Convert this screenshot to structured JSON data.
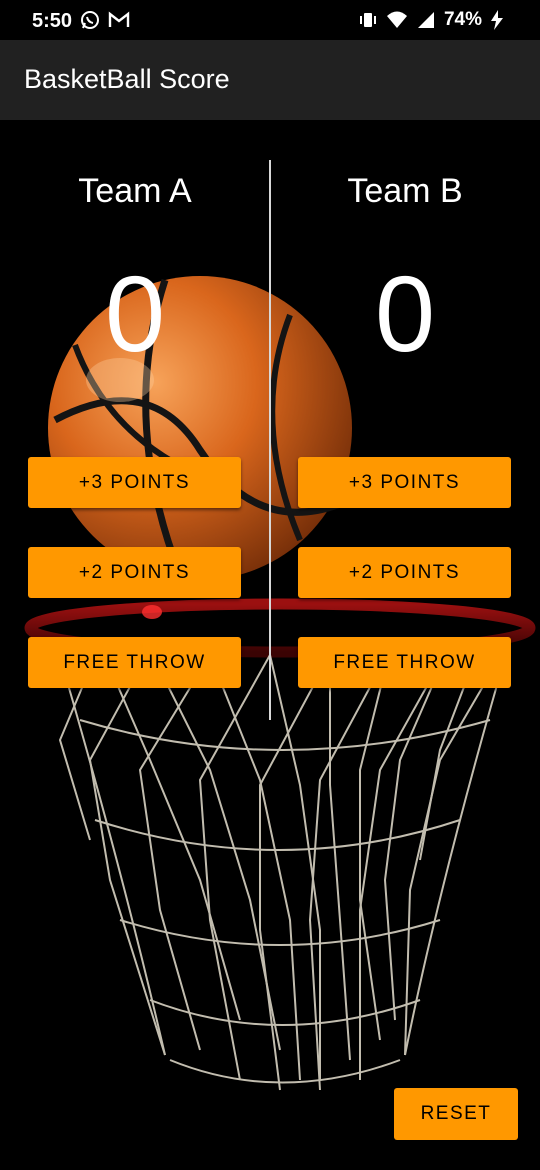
{
  "status_bar": {
    "time": "5:50",
    "battery": "74%",
    "icons": [
      "whatsapp-icon",
      "gmail-icon",
      "vibrate-icon",
      "wifi-icon",
      "signal-icon",
      "battery-charging-icon"
    ]
  },
  "app_bar": {
    "title": "BasketBall Score"
  },
  "team_a": {
    "name": "Team A",
    "score": "0",
    "btn_three": "+3 POINTS",
    "btn_two": "+2 POINTS",
    "btn_free": "FREE THROW"
  },
  "team_b": {
    "name": "Team B",
    "score": "0",
    "btn_three": "+3 POINTS",
    "btn_two": "+2 POINTS",
    "btn_free": "FREE THROW"
  },
  "reset_label": "RESET",
  "colors": {
    "accent": "#FF9800",
    "app_bar": "#212121",
    "background": "#000000"
  }
}
